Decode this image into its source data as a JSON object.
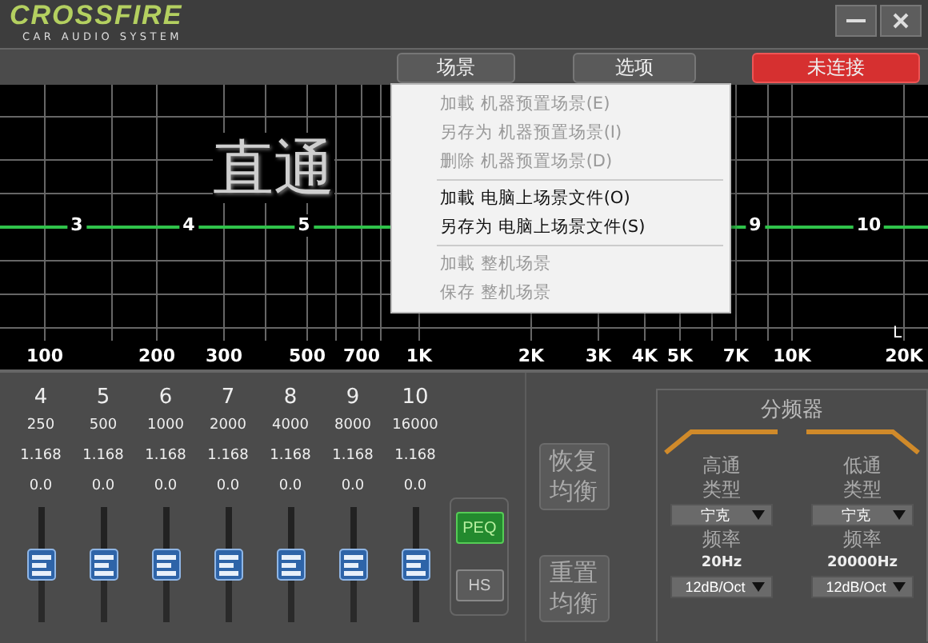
{
  "logo": {
    "brand": "CROSSFIRE",
    "tagline": "CAR AUDIO SYSTEM"
  },
  "toolbar": {
    "buttons": [
      {
        "label": "场景",
        "kind": "normal"
      },
      {
        "label": "选项",
        "kind": "normal"
      },
      {
        "label": "未连接",
        "kind": "alert"
      }
    ]
  },
  "graph": {
    "preset": "直通",
    "channel_label": "L",
    "bands": [
      "3",
      "4",
      "5",
      "9",
      "10"
    ],
    "x_labels": [
      "100",
      "200",
      "300",
      "500",
      "700",
      "1K",
      "2K",
      "3K",
      "4K",
      "5K",
      "7K",
      "10K",
      "20K"
    ]
  },
  "scene_menu": {
    "groups": [
      [
        {
          "label": "加載 机器预置场景(E)",
          "disabled": true
        },
        {
          "label": "另存为 机器预置场景(I)",
          "disabled": true
        },
        {
          "label": "删除 机器预置场景(D)",
          "disabled": true
        }
      ],
      [
        {
          "label": "加載 电脑上场景文件(O)",
          "disabled": false
        },
        {
          "label": "另存为 电脑上场景文件(S)",
          "disabled": false
        }
      ],
      [
        {
          "label": "加載 整机场景",
          "disabled": true
        },
        {
          "label": "保存 整机场景",
          "disabled": true
        }
      ]
    ]
  },
  "eq_channels": [
    {
      "band": "4",
      "frequency": "250",
      "q": "1.168",
      "gain": "0.0",
      "level": 0.5
    },
    {
      "band": "5",
      "frequency": "500",
      "q": "1.168",
      "gain": "0.0",
      "level": 0.5
    },
    {
      "band": "6",
      "frequency": "1000",
      "q": "1.168",
      "gain": "0.0",
      "level": 0.5
    },
    {
      "band": "7",
      "frequency": "2000",
      "q": "1.168",
      "gain": "0.0",
      "level": 0.5
    },
    {
      "band": "8",
      "frequency": "4000",
      "q": "1.168",
      "gain": "0.0",
      "level": 0.5
    },
    {
      "band": "9",
      "frequency": "8000",
      "q": "1.168",
      "gain": "0.0",
      "level": 0.5
    },
    {
      "band": "10",
      "frequency": "16000",
      "q": "1.168",
      "gain": "0.0",
      "level": 0.5
    }
  ],
  "filter_modes": [
    {
      "label": "PEQ",
      "selected": true
    },
    {
      "label": "HS",
      "selected": false
    }
  ],
  "eq_actions": [
    "恢复均衡",
    "重置均衡"
  ],
  "crossover": {
    "title": "分频器",
    "filters": [
      {
        "kind": "highpass",
        "name": "高通",
        "type_label": "类型",
        "type": "宁克",
        "freq_label": "频率",
        "frequency": "20Hz",
        "slope": "12dB/Oct"
      },
      {
        "kind": "lowpass",
        "name": "低通",
        "type_label": "类型",
        "type": "宁克",
        "freq_label": "频率",
        "frequency": "20000Hz",
        "slope": "12dB/Oct"
      }
    ]
  }
}
